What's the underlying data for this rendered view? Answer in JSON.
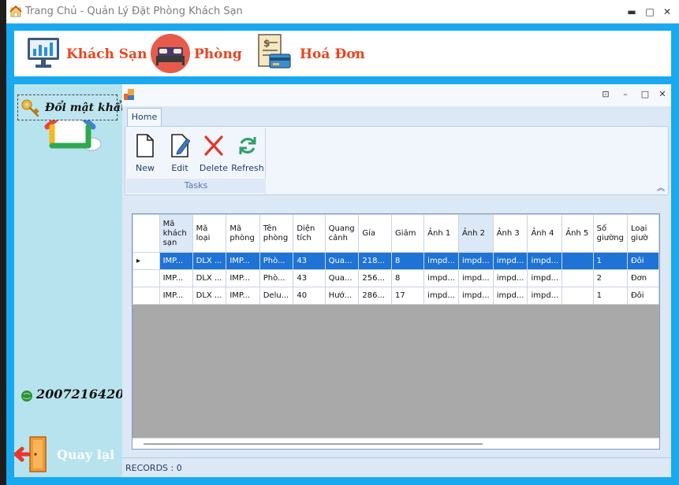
{
  "window": {
    "title": "Trang Chủ - Quản Lý Đặt Phòng Khách Sạn",
    "controls": {
      "minimize": "▬",
      "maximize": "□",
      "close": "✕"
    }
  },
  "topnav": {
    "items": [
      {
        "label": "Khách Sạn",
        "icon": "hotel-chart-icon"
      },
      {
        "label": "Phòng",
        "icon": "bed-icon"
      },
      {
        "label": "Hoá Đơn",
        "icon": "invoice-icon"
      }
    ]
  },
  "sidebar": {
    "logo_icon": "house-cloud-logo",
    "change_password_label": "Đổi mật khẩu",
    "user_id": "2007216420",
    "back_label": "Quay lại"
  },
  "child": {
    "controls": {
      "restore": "⊡",
      "minimize": "–",
      "maximize": "□",
      "close": "✕"
    },
    "ribbon": {
      "tab": "Home",
      "group": "Tasks",
      "buttons": [
        {
          "label": "New",
          "icon": "new-document-icon"
        },
        {
          "label": "Edit",
          "icon": "edit-document-icon"
        },
        {
          "label": "Delete",
          "icon": "delete-x-icon"
        },
        {
          "label": "Refresh",
          "icon": "refresh-icon"
        }
      ]
    },
    "grid": {
      "columns": [
        "Mã khách sạn",
        "Mã loại",
        "Mã phòng",
        "Tên phòng",
        "Diện tích",
        "Quang cảnh",
        "Gía",
        "Giảm",
        "Ảnh 1",
        "Ảnh 2",
        "Ảnh 3",
        "Ảnh 4",
        "Ảnh 5",
        "Số giường",
        "Loại giườ"
      ],
      "rows": [
        [
          "IMP...",
          "DLX ...",
          "IMP...",
          "Phò...",
          "43",
          "Qua...",
          "218...",
          "8",
          "impd...",
          "impd...",
          "impd...",
          "impd...",
          "",
          "1",
          "Đôi"
        ],
        [
          "IMP...",
          "DLX ...",
          "IMP...",
          "Phò...",
          "43",
          "Qua...",
          "256...",
          "8",
          "impd...",
          "impd...",
          "impd...",
          "impd...",
          "",
          "2",
          "Đơn"
        ],
        [
          "IMP...",
          "DLX ...",
          "IMP...",
          "Delu...",
          "40",
          "Hướ...",
          "286...",
          "17",
          "impd...",
          "impd...",
          "impd...",
          "impd...",
          "",
          "1",
          "Đôi"
        ]
      ],
      "selected_row": 0
    },
    "status": "RECORDS : 0"
  },
  "colors": {
    "accent": "#19a9ef",
    "nav_text": "#e8451f",
    "selection": "#1f73d4",
    "sidebar": "#b7e3ee"
  }
}
